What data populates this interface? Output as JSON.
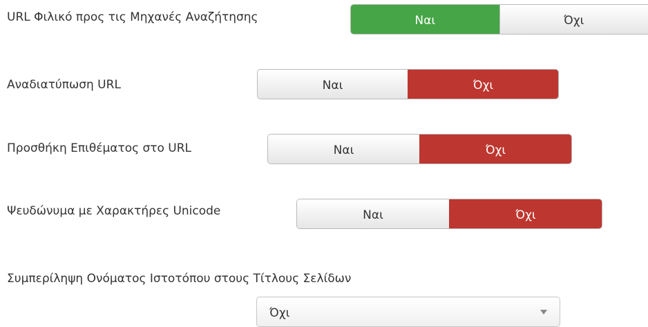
{
  "settings": [
    {
      "label": "URL Φιλικό προς τις Μηχανές Αναζήτησης",
      "yes_label": "Ναι",
      "no_label": "Όχι",
      "selected": "yes"
    },
    {
      "label": "Αναδιατύπωση URL",
      "yes_label": "Ναι",
      "no_label": "Όχι",
      "selected": "no"
    },
    {
      "label": "Προσθήκη Επιθέματος στο URL",
      "yes_label": "Ναι",
      "no_label": "Όχι",
      "selected": "no"
    },
    {
      "label": "Ψευδώνυμα με Χαρακτήρες Unicode",
      "yes_label": "Ναι",
      "no_label": "Όχι",
      "selected": "no"
    }
  ],
  "site_name_in_titles": {
    "label": "Συμπερίληψη Ονόματος Ιστοτόπου στους Τίτλους Σελίδων",
    "selected_value": "Όχι"
  },
  "colors": {
    "yes_active": "#46a546",
    "no_active": "#bd362f",
    "inactive": "#f2f2f2"
  }
}
